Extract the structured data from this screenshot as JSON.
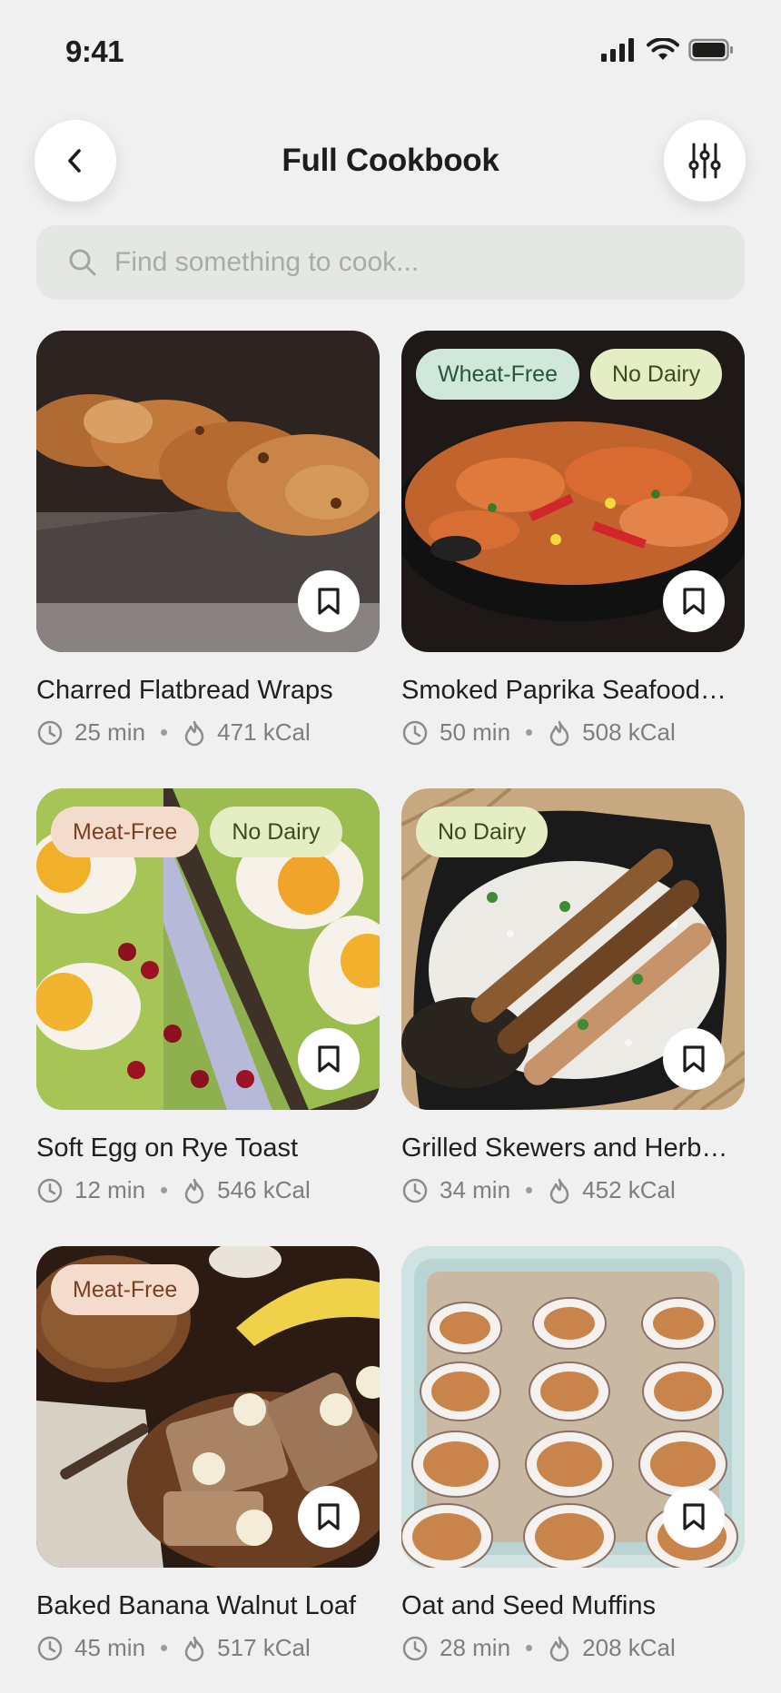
{
  "status_bar": {
    "time": "9:41"
  },
  "header": {
    "title": "Full Cookbook"
  },
  "search": {
    "placeholder": "Find something to cook..."
  },
  "recipes": [
    {
      "name": "Charred Flatbread Wraps",
      "time": "25 min",
      "kcal": "471 kCal",
      "tags": []
    },
    {
      "name": "Smoked Paprika Seafood…",
      "time": "50 min",
      "kcal": "508 kCal",
      "tags": [
        "Wheat-Free",
        "No Dairy"
      ]
    },
    {
      "name": "Soft Egg on Rye Toast",
      "time": "12 min",
      "kcal": "546 kCal",
      "tags": [
        "Meat-Free",
        "No Dairy"
      ]
    },
    {
      "name": "Grilled Skewers and Herb…",
      "time": "34 min",
      "kcal": "452 kCal",
      "tags": [
        "No Dairy"
      ]
    },
    {
      "name": "Baked Banana Walnut Loaf",
      "time": "45 min",
      "kcal": "517 kCal",
      "tags": [
        "Meat-Free"
      ]
    },
    {
      "name": "Oat and Seed Muffins",
      "time": "28 min",
      "kcal": "208 kCal",
      "tags": []
    }
  ],
  "meta_separator": "•",
  "colors": {
    "background": "#eff0ef",
    "tag_green": "#cfe8da",
    "tag_lime": "#e5edc4",
    "tag_peach": "#f4dccd"
  },
  "icons": [
    "back-icon",
    "filter-sliders-icon",
    "search-icon",
    "bookmark-icon",
    "clock-icon",
    "flame-icon"
  ]
}
